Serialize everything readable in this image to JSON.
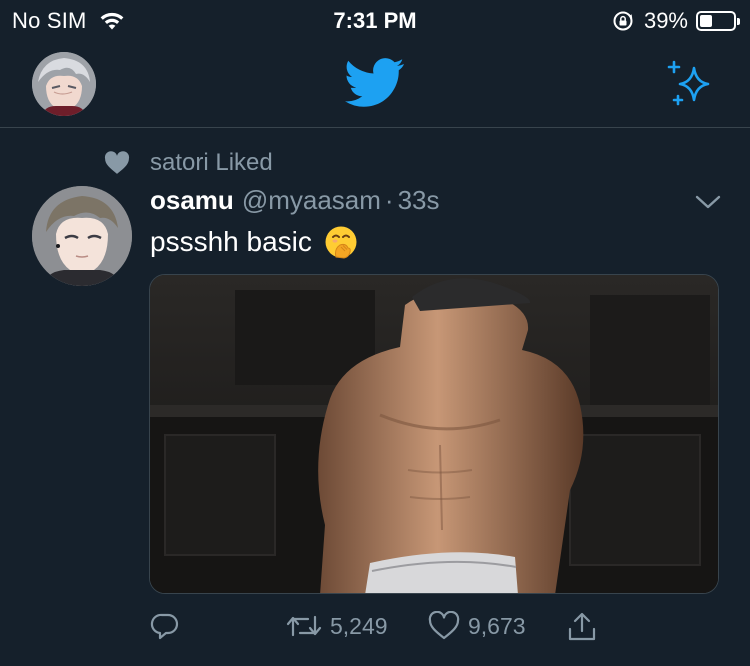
{
  "status_bar": {
    "carrier": "No SIM",
    "time": "7:31 PM",
    "battery": "39%",
    "battery_level": 0.39
  },
  "header": {
    "logo_icon": "twitter-bird-icon",
    "compose_icon": "sparkle-icon",
    "accent_color": "#1da1f2"
  },
  "tweet": {
    "social_context": "satori Liked",
    "display_name": "osamu",
    "handle": "@myaasam",
    "separator": "·",
    "time": "33s",
    "text": "pssshh basic",
    "emoji_icon": "face-with-hand-over-mouth-emoji",
    "retweet_count": "5,249",
    "like_count": "9,673"
  },
  "colors": {
    "background": "#15202b",
    "secondary_text": "#8899a6",
    "divider": "#38444d"
  }
}
